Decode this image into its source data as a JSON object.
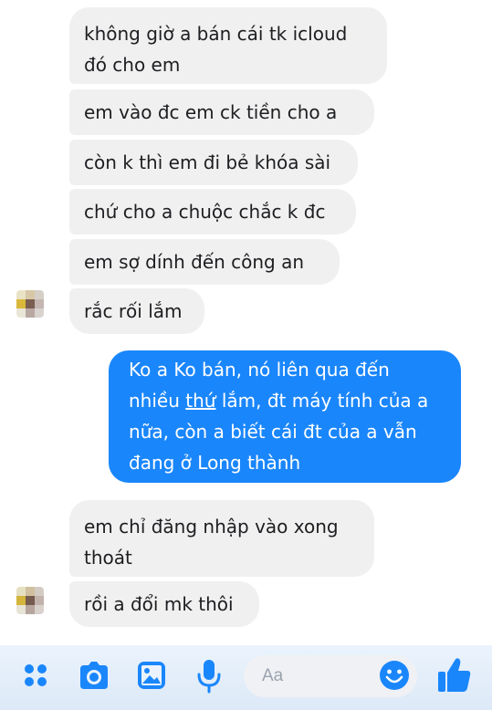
{
  "messages": [
    {
      "dir": "in",
      "lines": [
        "không giờ a bán cái tk icloud",
        "đó cho em"
      ]
    },
    {
      "dir": "in",
      "lines": [
        "em vào đc em ck tiền cho a"
      ]
    },
    {
      "dir": "in",
      "lines": [
        "còn k thì em đi bẻ khóa sài"
      ]
    },
    {
      "dir": "in",
      "lines": [
        "chứ cho a chuộc chắc k đc"
      ]
    },
    {
      "dir": "in",
      "lines": [
        "em sợ dính đến công an"
      ]
    },
    {
      "dir": "in",
      "lines": [
        "rắc rối lắm"
      ]
    },
    {
      "dir": "out",
      "lines": [
        "Ko a Ko bán, nó liên qua đến",
        "nhiều",
        "thứ",
        "lắm, đt máy tính của a",
        "nữa, còn a biết cái đt của a vẫn",
        "đang ở Long thành"
      ]
    },
    {
      "dir": "in",
      "lines": [
        "em chỉ đăng nhập vào xong",
        "thoát"
      ]
    },
    {
      "dir": "in",
      "lines": [
        "rồi a đổi mk thôi"
      ]
    }
  ],
  "composer": {
    "placeholder": "Aa"
  },
  "toolbar": {
    "icons": [
      "grid-icon",
      "camera-icon",
      "gallery-icon",
      "microphone-icon",
      "emoji-icon",
      "thumbs-up-icon"
    ]
  },
  "colors": {
    "incoming_bubble": "#f1f0f0",
    "outgoing_bubble": "#1a86fb",
    "accent": "#1a86fb"
  }
}
